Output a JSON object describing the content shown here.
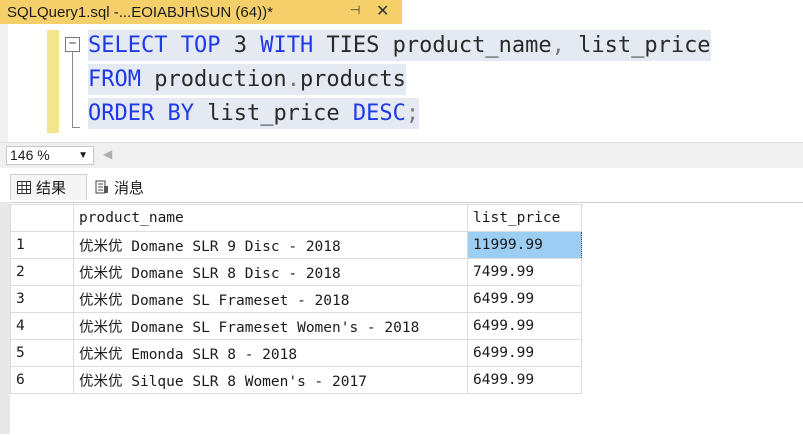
{
  "tab": {
    "title": "SQLQuery1.sql -...EOIABJH\\SUN (64))*",
    "pin_glyph": "⊣",
    "close_glyph": "✕"
  },
  "editor": {
    "line1": {
      "kw1": "SELECT TOP",
      "t1": " 3 ",
      "kw2": "WITH",
      "t2": " TIES product_name",
      "p1": ",",
      "t3": " list_price"
    },
    "line2": {
      "kw1": "FROM",
      "t1": " production",
      "p1": ".",
      "t2": "products"
    },
    "line3": {
      "kw1": "ORDER BY",
      "t1": " list_price ",
      "kw2": "DESC",
      "p1": ";"
    }
  },
  "status": {
    "zoom": "146 %"
  },
  "results_tabs": {
    "results": "结果",
    "messages": "消息"
  },
  "grid": {
    "columns": [
      "product_name",
      "list_price"
    ],
    "rows": [
      {
        "n": "1",
        "product_name": "优米优 Domane SLR 9 Disc - 2018",
        "list_price": "11999.99"
      },
      {
        "n": "2",
        "product_name": "优米优 Domane SLR 8 Disc - 2018",
        "list_price": "7499.99"
      },
      {
        "n": "3",
        "product_name": "优米优 Domane SL Frameset - 2018",
        "list_price": "6499.99"
      },
      {
        "n": "4",
        "product_name": "优米优 Domane SL Frameset Women's - 2018",
        "list_price": "6499.99"
      },
      {
        "n": "5",
        "product_name": "优米优 Emonda SLR 8 - 2018",
        "list_price": "6499.99"
      },
      {
        "n": "6",
        "product_name": "优米优 Silque SLR 8 Women's - 2017",
        "list_price": "6499.99"
      }
    ]
  }
}
